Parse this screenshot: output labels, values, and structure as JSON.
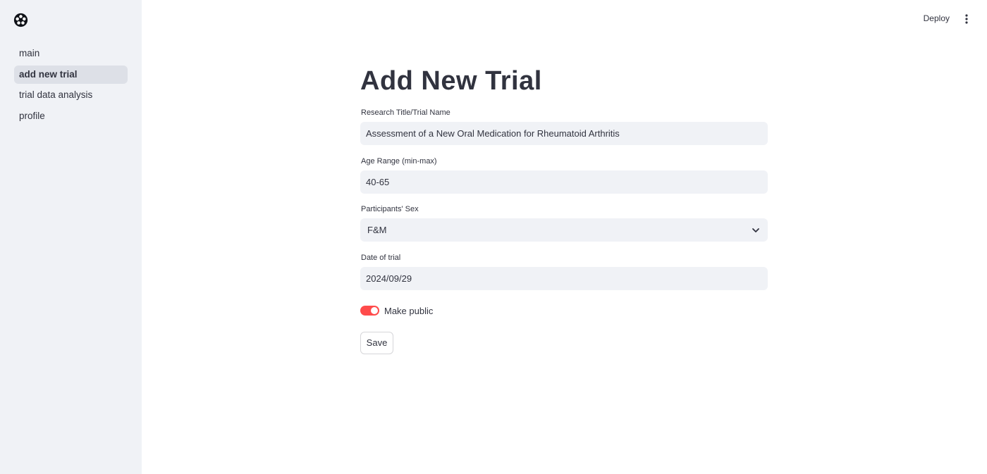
{
  "sidebar": {
    "logo_icon": "streamlit-logo-icon",
    "items": [
      {
        "label": "main",
        "active": false
      },
      {
        "label": "add new trial",
        "active": true
      },
      {
        "label": "trial data analysis",
        "active": false
      },
      {
        "label": "profile",
        "active": false
      }
    ]
  },
  "header": {
    "deploy_label": "Deploy",
    "menu_icon": "vertical-dots-icon"
  },
  "main": {
    "title": "Add New Trial",
    "fields": {
      "research_title": {
        "label": "Research Title/Trial Name",
        "value": "Assessment of a New Oral Medication for Rheumatoid Arthritis"
      },
      "age_range": {
        "label": "Age Range (min-max)",
        "value": "40-65"
      },
      "participants_sex": {
        "label": "Participants' Sex",
        "value": "F&M"
      },
      "date_of_trial": {
        "label": "Date of trial",
        "value": "2024/09/29"
      }
    },
    "make_public": {
      "label": "Make public",
      "checked": true
    },
    "save_label": "Save"
  },
  "colors": {
    "sidebar_bg": "#f0f2f6",
    "accent": "#ff4b4b",
    "text": "#31333f",
    "input_bg": "#f0f2f6"
  }
}
